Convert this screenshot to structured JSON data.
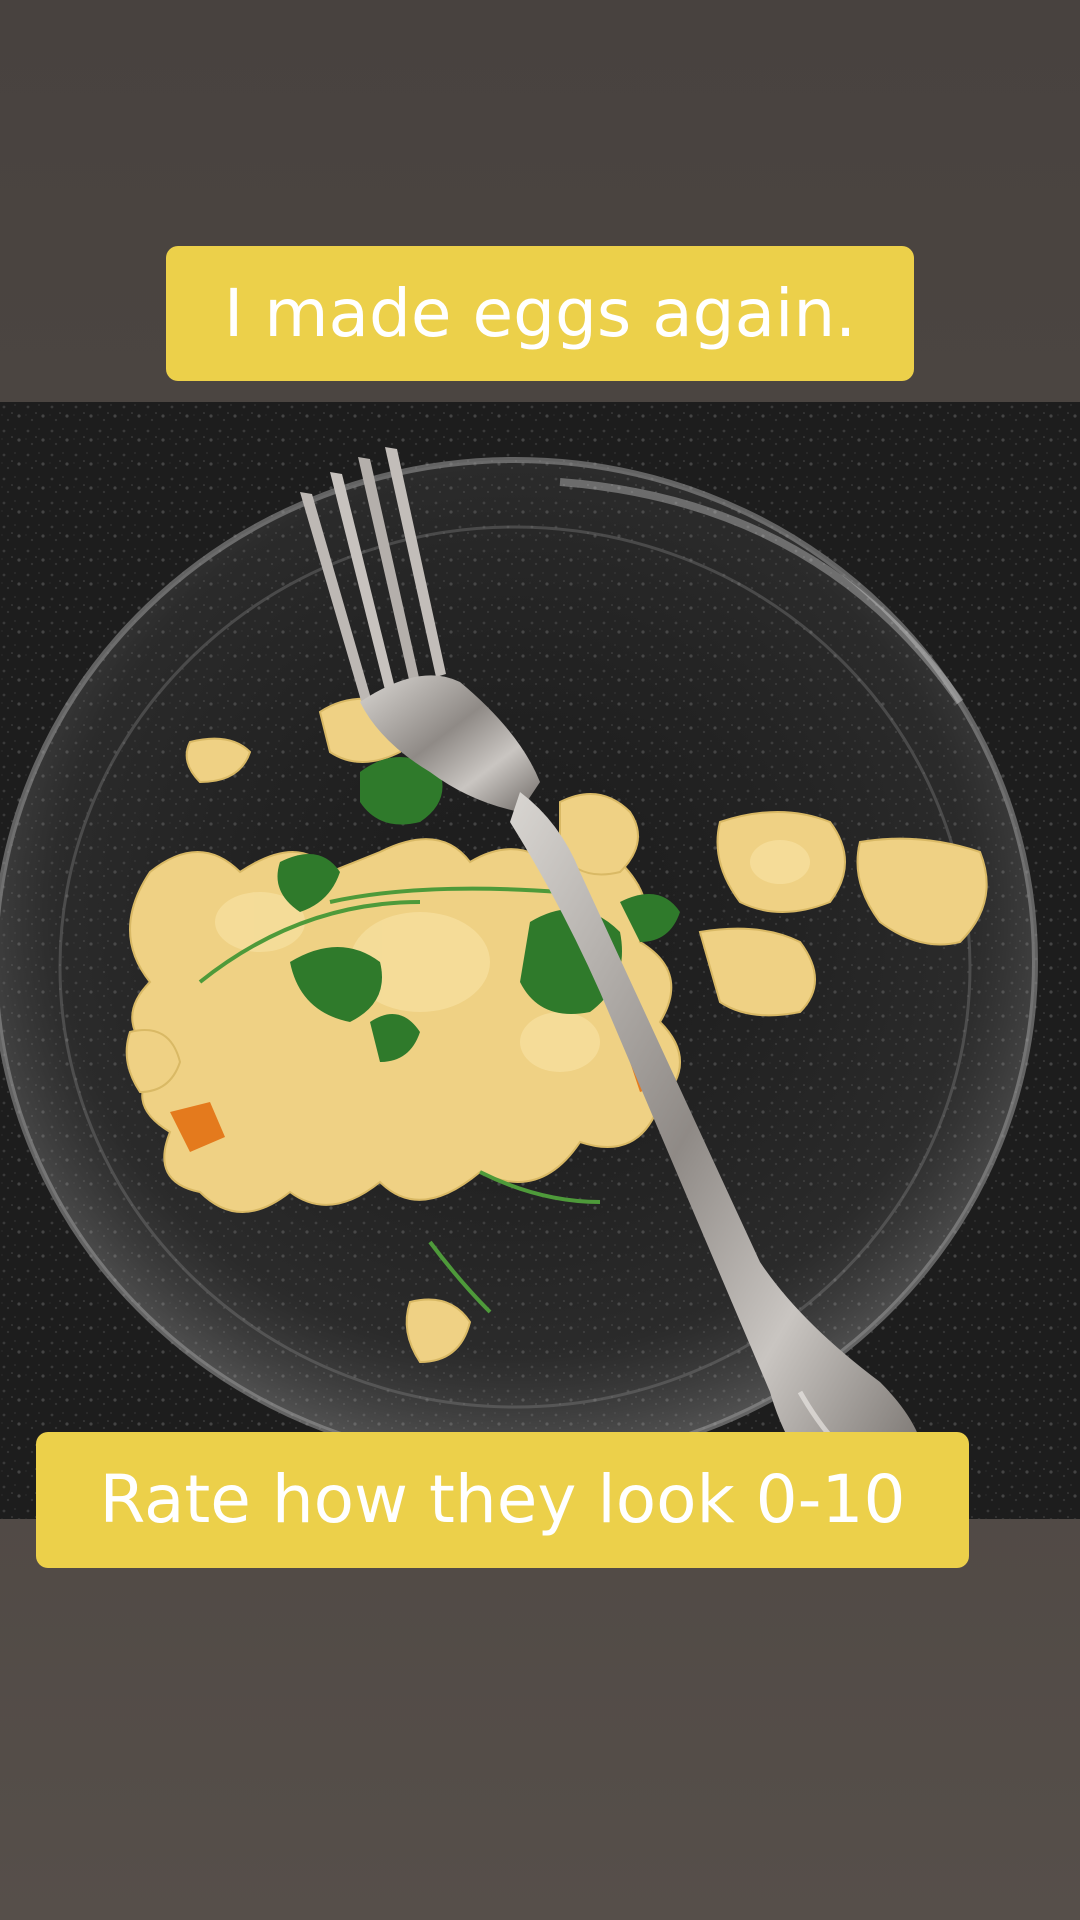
{
  "captions": {
    "top": "I made eggs again.",
    "bottom": "Rate how they look 0-10"
  },
  "photo": {
    "subject": "scrambled eggs with cilantro on a glass plate with a fork"
  },
  "colors": {
    "caption_background": "#ecd04a",
    "caption_text": "#ffffff",
    "page_background": "#4b4541"
  }
}
